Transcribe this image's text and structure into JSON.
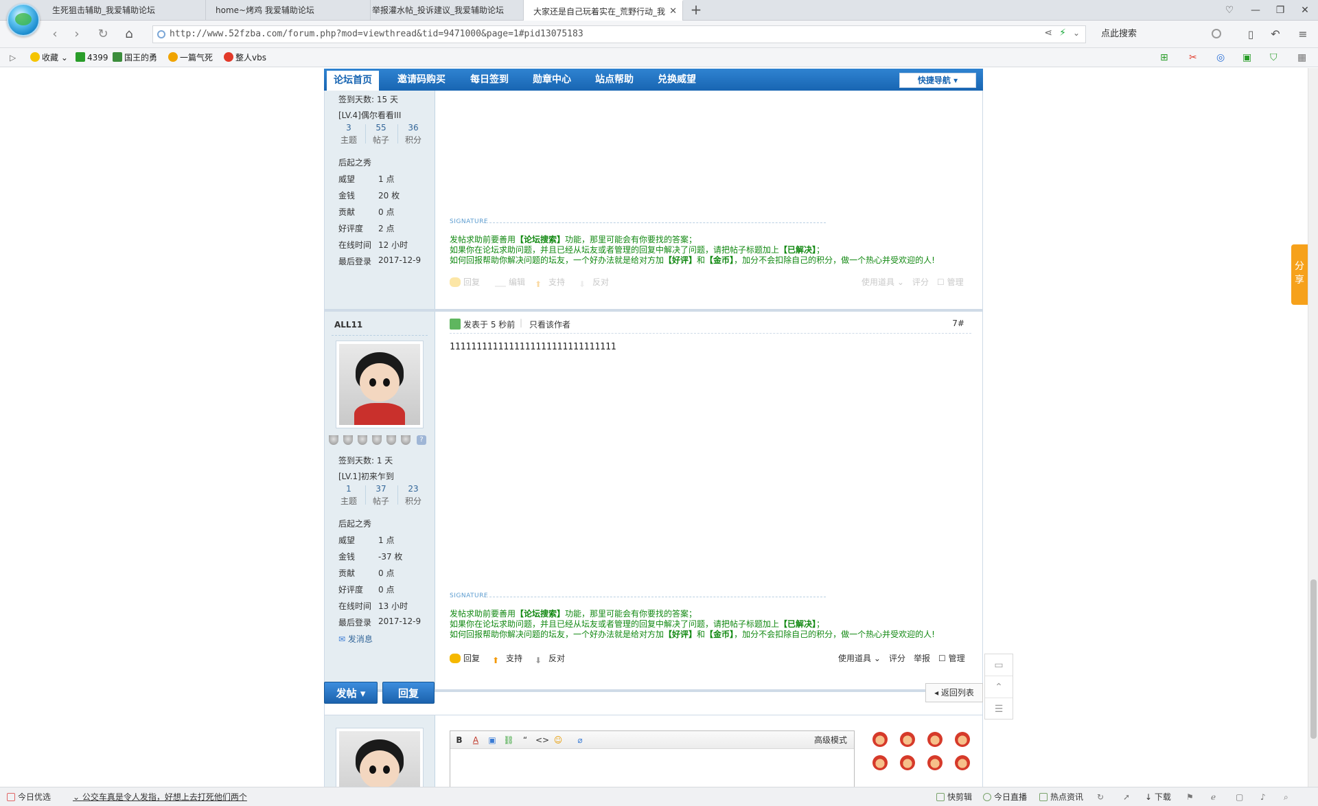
{
  "browser": {
    "tabs": [
      {
        "title": "生死狙击辅助_我爱辅助论坛"
      },
      {
        "title": "home~烤鸡 我爱辅助论坛"
      },
      {
        "title": "举报灌水帖_投诉建议_我爱辅助论坛"
      },
      {
        "title": "大家还是自己玩着实在_荒野行动_我"
      }
    ],
    "url": "http://www.52fzba.com/forum.php?mod=viewthread&tid=9471000&page=1#pid13075183",
    "search_placeholder": "点此搜索",
    "bookmarks": [
      "收藏",
      "4399",
      "国王的勇",
      "一篇气死",
      "整人vbs"
    ]
  },
  "forum_nav": {
    "items": [
      "论坛首页",
      "邀请码购买",
      "每日签到",
      "勋章中心",
      "站点帮助",
      "兑换威望"
    ],
    "quick_nav": "快捷导航"
  },
  "post1": {
    "sign_days": "签到天数: 15 天",
    "level": "[LV.4]偶尔看看III",
    "stats": [
      {
        "n": "3",
        "l": "主题"
      },
      {
        "n": "55",
        "l": "帖子"
      },
      {
        "n": "36",
        "l": "积分"
      }
    ],
    "group": "后起之秀",
    "fields": [
      {
        "k": "威望",
        "v": "1 点"
      },
      {
        "k": "金钱",
        "v": "20 枚"
      },
      {
        "k": "贡献",
        "v": "0 点"
      },
      {
        "k": "好评度",
        "v": "2 点"
      },
      {
        "k": "在线时间",
        "v": "12 小时"
      },
      {
        "k": "最后登录",
        "v": "2017-12-9"
      }
    ]
  },
  "signature": {
    "label": "SIGNATURE",
    "line1_pre": "发帖求助前要善用",
    "line1_b": "【论坛搜索】",
    "line1_post": "功能，那里可能会有你要找的答案；",
    "line2_pre": "如果你在论坛求助问题，并且已经从坛友或者管理的回复中解决了问题，请把帖子标题加上",
    "line2_b": "【已解决】",
    "line2_post": "；",
    "line3_pre": "如何回报帮助你解决问题的坛友，一个好办法就是给对方加",
    "line3_b1": "【好评】",
    "line3_mid": "和",
    "line3_b2": "【金币】",
    "line3_post": "，加分不会扣除自己的积分，做一个热心并受欢迎的人!"
  },
  "actions": {
    "reply": "回复",
    "edit": "编辑",
    "support": "支持",
    "oppose": "反对",
    "use_item": "使用道具",
    "rate": "评分",
    "report": "举报",
    "manage": "管理"
  },
  "post2": {
    "author": "ALL11",
    "posted": "发表于 5 秒前",
    "only_author": "只看该作者",
    "floor": "7#",
    "content": "1111111111111111111111111111111",
    "sign_days": "签到天数: 1 天",
    "level": "[LV.1]初来乍到",
    "stats": [
      {
        "n": "1",
        "l": "主题"
      },
      {
        "n": "37",
        "l": "帖子"
      },
      {
        "n": "23",
        "l": "积分"
      }
    ],
    "group": "后起之秀",
    "fields": [
      {
        "k": "威望",
        "v": "1 点"
      },
      {
        "k": "金钱",
        "v": "-37 枚"
      },
      {
        "k": "贡献",
        "v": "0 点"
      },
      {
        "k": "好评度",
        "v": "0 点"
      },
      {
        "k": "在线时间",
        "v": "13 小时"
      },
      {
        "k": "最后登录",
        "v": "2017-12-9"
      }
    ],
    "send_message": "发消息"
  },
  "bottom": {
    "new_post": "发帖",
    "reply": "回复",
    "back_list": "返回列表"
  },
  "editor": {
    "bold": "B",
    "quote": "“",
    "code": "<>",
    "advanced": "高级模式"
  },
  "share": "分享",
  "statusbar": {
    "today": "今日优选",
    "news": "公交车真是令人发指，好想上去打死他们两个",
    "right": [
      "快剪辑",
      "今日直播",
      "热点资讯",
      "下载"
    ]
  }
}
